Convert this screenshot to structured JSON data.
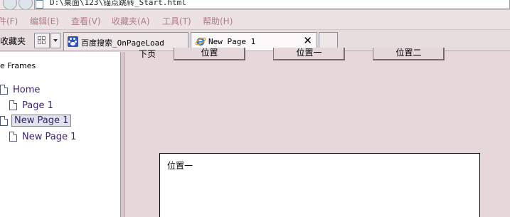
{
  "address": {
    "path": "D:\\桌面\\123\\锚点跳转_Start.html"
  },
  "menu": [
    {
      "label": "件(F)"
    },
    {
      "label": "编辑(E)"
    },
    {
      "label": "查看(V)"
    },
    {
      "label": "收藏夹(A)"
    },
    {
      "label": "工具(T)"
    },
    {
      "label": "帮助(H)"
    }
  ],
  "favorites": {
    "label": "收藏夹"
  },
  "tabs": [
    {
      "label": "百度搜索_OnPageLoad",
      "icon": "baidu-paw-icon"
    },
    {
      "label": "New Page 1",
      "icon": "ie-icon",
      "close": "✕"
    }
  ],
  "left_frame": {
    "title": "e Frames",
    "items": [
      {
        "label": "Home"
      },
      {
        "label": "Page 1"
      },
      {
        "label": "New Page 1"
      },
      {
        "label": "New Page 1"
      }
    ]
  },
  "main_frame": {
    "next_label": "下页",
    "buttons": [
      {
        "label": "位置"
      },
      {
        "label": "位置一"
      },
      {
        "label": "位置二"
      }
    ],
    "content_label": "位置一"
  },
  "colors": {
    "background": "#e6d8da",
    "link": "#3b1f6f",
    "menu_text": "#b07c86"
  }
}
